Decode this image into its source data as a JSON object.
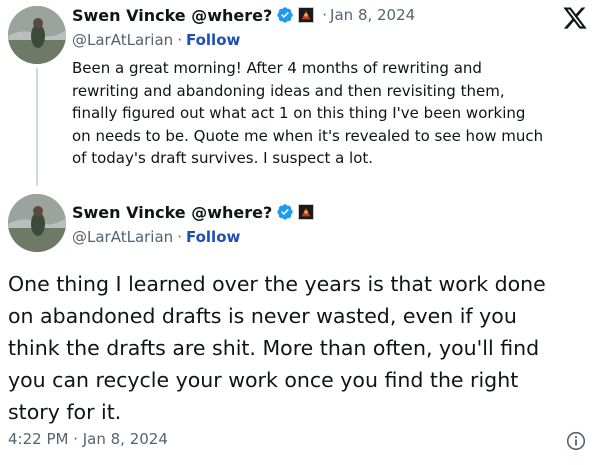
{
  "quoted_tweet": {
    "display_name": "Swen Vincke @where?",
    "handle": "@LarAtLarian",
    "follow_label": "Follow",
    "separator": "·",
    "date": "Jan 8, 2024",
    "text_lines": [
      "Been a great morning! After 4 months of rewriting and",
      "rewriting and abandoning ideas and then revisiting them,",
      "finally figured out what act 1 on this thing I've been working",
      "on needs to be. Quote me when it's revealed to see how much",
      "of today's draft survives. I suspect a lot."
    ]
  },
  "main_tweet": {
    "display_name": "Swen Vincke @where?",
    "handle": "@LarAtLarian",
    "follow_label": "Follow",
    "separator": "·",
    "text_lines": [
      "One thing I learned over the years is that work done",
      "on abandoned drafts is never wasted, even if you",
      "think the drafts are shit. More than often, you'll find",
      "you can recycle your work once you find the right",
      "story for it."
    ],
    "timestamp": "4:22 PM · Jan 8, 2024"
  },
  "icons": {
    "logo": "x-logo-icon",
    "verified": "verified-badge-icon",
    "affiliate": "affiliate-badge-icon",
    "info": "info-icon"
  },
  "colors": {
    "text": "#0f1419",
    "secondary": "#536471",
    "link": "#1d4fb8",
    "verified": "#1d9bf0"
  }
}
